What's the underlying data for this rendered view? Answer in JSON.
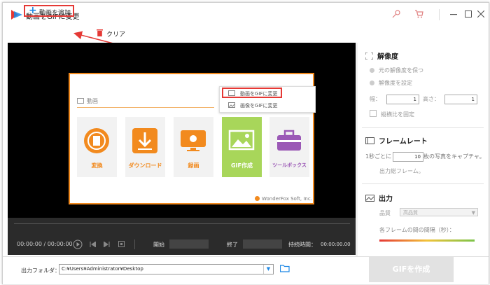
{
  "titlebar": {
    "title": "動画をGIFに変更",
    "icons": [
      "app-logo-icon",
      "key-icon",
      "cart-icon",
      "minimize-icon",
      "maximize-icon",
      "close-icon"
    ]
  },
  "toolbar": {
    "add_label": "動画を追加",
    "clear_label": "クリア"
  },
  "card": {
    "section_label": "動画",
    "tiles": [
      {
        "label": "変換",
        "icon": "convert-icon"
      },
      {
        "label": "ダウンロード",
        "icon": "download-icon"
      },
      {
        "label": "録画",
        "icon": "record-screen-icon"
      },
      {
        "label": "GIF作成",
        "icon": "gif-image-icon"
      },
      {
        "label": "ツールボックス",
        "icon": "toolbox-icon"
      }
    ],
    "menu": [
      {
        "label": "動画をGIFに変更"
      },
      {
        "label": "画像をGIFに変更"
      }
    ],
    "brand": "WonderFox Soft, Inc."
  },
  "controls": {
    "time": "00:00:00  /  00:00:00",
    "start_label": "開始",
    "end_label": "終了",
    "duration_label": "持続時間：",
    "duration_value": "00:00:00.00"
  },
  "right": {
    "resolution": {
      "title": "解像度",
      "keep_original": "元の解像度を保つ",
      "set_resolution": "解像度を設定",
      "width_label": "幅：",
      "width_value": "1",
      "height_label": "高さ：",
      "height_value": "1",
      "fix_aspect": "縦横比を固定"
    },
    "framerate": {
      "title": "フレームレート",
      "prefix": "1秒ごとに",
      "value": "10",
      "suffix": "枚の写真をキャプチャ。",
      "output_frames": "出力総フレーム。"
    },
    "output": {
      "title": "出力",
      "quality_label": "品質",
      "quality_value": "高品質",
      "interval_label": "各フレームの間の間隔（秒）："
    }
  },
  "bottom": {
    "folder_label": "出力フォルダ：",
    "folder_path": "C:¥Users¥Administrator¥Desktop",
    "convert_label": "GIFを作成"
  },
  "colors": {
    "accent_orange": "#f28a1e",
    "highlight_red": "#e53935",
    "gif_tile_green": "#a8d65a",
    "toolbox_purple": "#9b59b6"
  }
}
